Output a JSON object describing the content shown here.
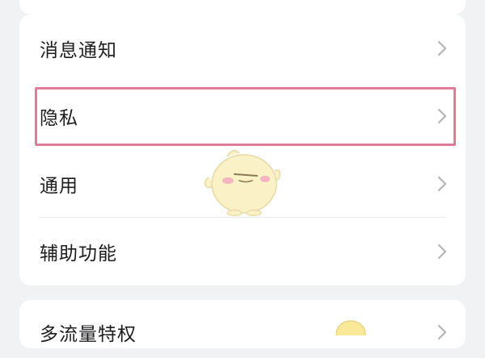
{
  "settings": {
    "items": [
      {
        "label": "消息通知"
      },
      {
        "label": "隐私"
      },
      {
        "label": "通用"
      },
      {
        "label": "辅助功能"
      }
    ],
    "next_group": {
      "label": "多流量特权"
    }
  },
  "colors": {
    "background": "#f1f2f4",
    "card": "#ffffff",
    "highlight": "#df7a98",
    "chevron": "#b4b4b8"
  },
  "icons": [
    "chevron-right-icon",
    "mascot-sticker-icon"
  ]
}
